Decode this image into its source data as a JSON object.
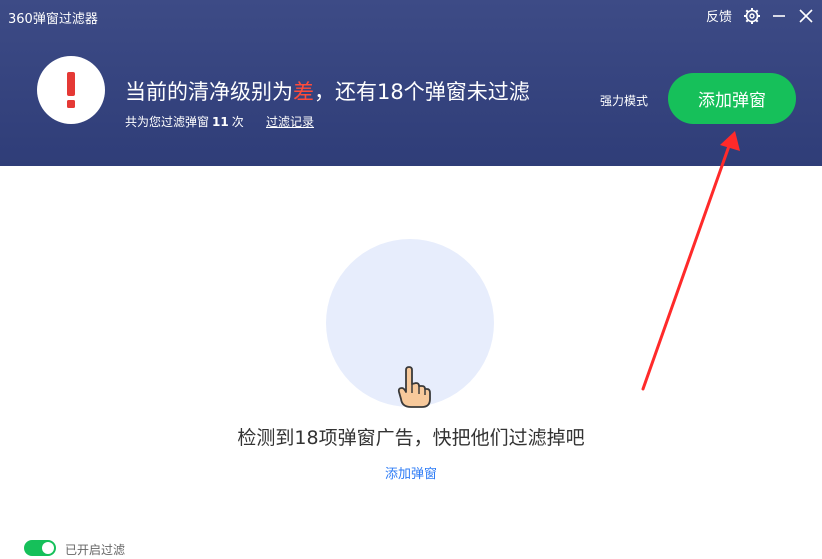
{
  "app": {
    "title": "360弹窗过滤器"
  },
  "titlebar": {
    "feedback_label": "反馈",
    "settings_icon": "gear-icon",
    "minimize_icon": "minimize-icon",
    "close_icon": "close-icon"
  },
  "header": {
    "status_icon": "exclamation-icon",
    "headline_prefix": "当前的清净级别为",
    "headline_level": "差",
    "headline_suffix": "，还有18个弹窗未过滤",
    "subline_prefix": "共为您过滤弹窗",
    "subline_count": "11",
    "subline_suffix": "次",
    "history_link": "过滤记录",
    "mode_label": "强力模式",
    "add_button": "添加弹窗"
  },
  "main": {
    "illustration_icon": "pointing-hand-icon",
    "detect_text": "检测到18项弹窗广告，快把他们过滤掉吧",
    "add_link": "添加弹窗"
  },
  "footer": {
    "toggle_label": "已开启过滤",
    "toggle_on": true
  },
  "colors": {
    "header_bg": "#34427c",
    "accent_green": "#16c05a",
    "warning_red": "#e53935",
    "link_blue": "#2e7cf6",
    "annotation_red": "#ff2a2a"
  }
}
